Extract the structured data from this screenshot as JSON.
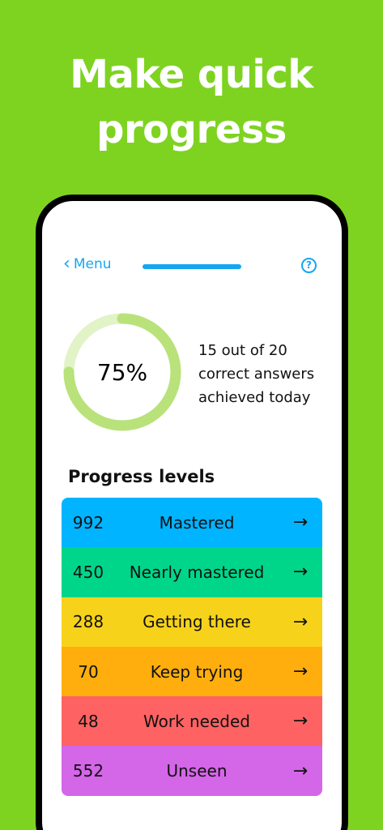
{
  "headline": {
    "line1": "Make quick",
    "line2": "progress"
  },
  "topbar": {
    "back_label": "Menu",
    "back_icon": "chevron-left-icon",
    "help_icon": "question-circle-icon",
    "help_glyph": "?"
  },
  "progress": {
    "percent_label": "75%",
    "fraction": 0.75,
    "summary_line1": "15 out of 20",
    "summary_line2": "correct answers",
    "summary_line3": "achieved today",
    "ring_fill_color": "#b9e27a",
    "ring_track_color": "#e2f3c8"
  },
  "levels": {
    "title": "Progress levels",
    "arrow_glyph": "→",
    "items": [
      {
        "count": "992",
        "label": "Mastered",
        "color": "#00b4ff"
      },
      {
        "count": "450",
        "label": "Nearly mastered",
        "color": "#00d68a"
      },
      {
        "count": "288",
        "label": "Getting there",
        "color": "#f7d21a"
      },
      {
        "count": "70",
        "label": "Keep trying",
        "color": "#ffae0d"
      },
      {
        "count": "48",
        "label": "Work needed",
        "color": "#ff6262"
      },
      {
        "count": "552",
        "label": "Unseen",
        "color": "#d466e8"
      }
    ]
  },
  "colors": {
    "background": "#7ed321",
    "accent": "#16a6f0"
  }
}
